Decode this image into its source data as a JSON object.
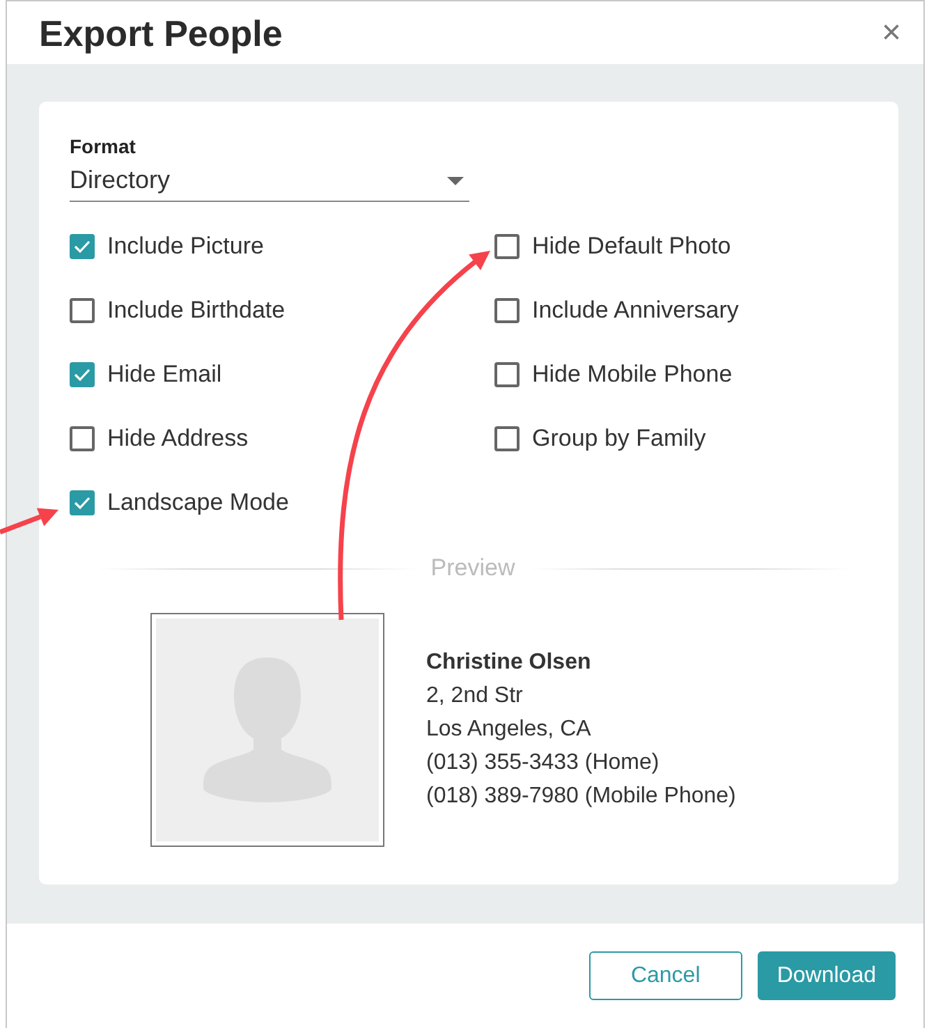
{
  "dialog": {
    "title": "Export People",
    "close": "×"
  },
  "format": {
    "label": "Format",
    "value": "Directory"
  },
  "options_left": [
    {
      "label": "Include Picture",
      "checked": true
    },
    {
      "label": "Include Birthdate",
      "checked": false
    },
    {
      "label": "Hide Email",
      "checked": true
    },
    {
      "label": "Hide Address",
      "checked": false
    },
    {
      "label": "Landscape Mode",
      "checked": true
    }
  ],
  "options_right": [
    {
      "label": "Hide Default Photo",
      "checked": false
    },
    {
      "label": "Include Anniversary",
      "checked": false
    },
    {
      "label": "Hide Mobile Phone",
      "checked": false
    },
    {
      "label": "Group by Family",
      "checked": false
    }
  ],
  "preview": {
    "heading": "Preview",
    "name": "Christine Olsen",
    "lines": [
      "2, 2nd Str",
      "Los Angeles, CA",
      "(013) 355-3433 (Home)",
      "(018) 389-7980 (Mobile Phone)"
    ]
  },
  "buttons": [
    {
      "label": "Cancel",
      "kind": "outline"
    },
    {
      "label": "Download",
      "kind": "primary"
    }
  ]
}
